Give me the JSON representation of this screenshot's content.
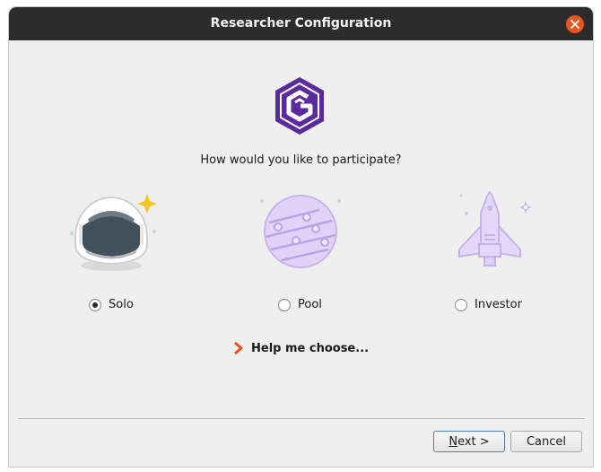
{
  "window": {
    "title": "Researcher Configuration",
    "close_icon": "close-icon"
  },
  "main": {
    "logo_icon": "gridcoin-logo",
    "question": "How would you like to participate?",
    "options": [
      {
        "label": "Solo",
        "icon": "astronaut-helmet-icon",
        "selected": true
      },
      {
        "label": "Pool",
        "icon": "planet-icon",
        "selected": false
      },
      {
        "label": "Investor",
        "icon": "space-shuttle-icon",
        "selected": false
      }
    ],
    "help_link": {
      "icon": "chevron-right-icon",
      "label": "Help me choose..."
    }
  },
  "footer": {
    "next_label": "Next >",
    "next_mnemonic": "N",
    "next_rest": "ext >",
    "cancel_label": "Cancel"
  },
  "colors": {
    "titlebar": "#2c2c2c",
    "close": "#e95420",
    "logo": "#5b2a9e",
    "illustration_lavender": "#d8c8f2",
    "help_chevron": "#e2541c"
  }
}
